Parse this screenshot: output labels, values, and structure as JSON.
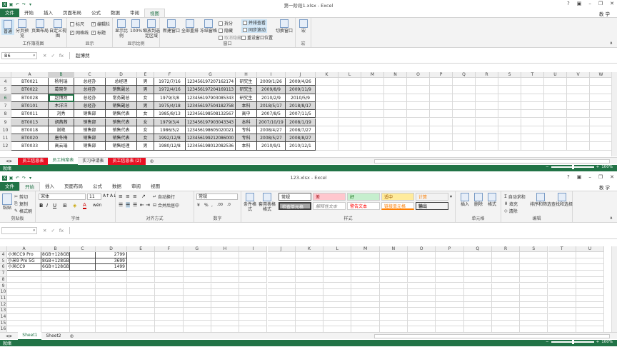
{
  "w1": {
    "title": "第一阶段1.xlsx - Excel",
    "user": "教 学",
    "tabs": [
      "文件",
      "开始",
      "插入",
      "页面布局",
      "公式",
      "数据",
      "审阅",
      "视图"
    ],
    "ribbon": {
      "workbook_views": {
        "label": "工作簿视图",
        "normal": "普通",
        "page_break": "分页预览",
        "page_layout": "页面布局",
        "custom": "自定义视图"
      },
      "show": {
        "label": "显示",
        "ruler": "标尺",
        "gridlines": "网格线",
        "formula_bar": "编辑栏",
        "headings": "标题"
      },
      "zoom": {
        "label": "显示比例",
        "zoom": "显示比例",
        "hundred": "100%",
        "to_selection": "缩放到选定区域"
      },
      "window": {
        "label": "窗口",
        "new_window": "新建窗口",
        "arrange_all": "全部重排",
        "freeze": "冻结窗格",
        "split": "拆分",
        "hide": "隐藏",
        "unhide": "取消隐藏",
        "side_by_side": "并排查看",
        "sync_scroll": "同步滚动",
        "reset_pos": "重设窗口位置",
        "switch": "切换窗口"
      },
      "macros": {
        "label": "宏",
        "macro": "宏"
      }
    },
    "namebox": "B6",
    "formula": "赵博然",
    "columns": [
      "A",
      "B",
      "C",
      "D",
      "E",
      "F",
      "G",
      "H",
      "I",
      "J",
      "K",
      "L",
      "M",
      "N",
      "O",
      "P",
      "Q",
      "R",
      "S",
      "T",
      "U",
      "V",
      "W"
    ],
    "rows": [
      {
        "n": "4",
        "cells": [
          "BT0021",
          "杨利瑞",
          "总经办",
          "总经理",
          "男",
          "1972/7/16",
          "123456197207162174",
          "研究生",
          "2009/1/26",
          "2009/4/26"
        ]
      },
      {
        "n": "5",
        "cells": [
          "BT0022",
          "葛晓冬",
          "总经办",
          "销售副总",
          "男",
          "1972/4/16",
          "123456197204169113",
          "研究生",
          "2009/8/9",
          "2009/11/9"
        ]
      },
      {
        "n": "6",
        "cells": [
          "BT0028",
          "赵博然",
          "总经办",
          "常务副总",
          "女",
          "1979/3/8",
          "123456197903085343",
          "研究生",
          "2010/2/9",
          "2010/5/9"
        ]
      },
      {
        "n": "7",
        "cells": [
          "BT0101",
          "木洋洋",
          "总经办",
          "销售副总",
          "男",
          "1975/4/18",
          "123456197504182758",
          "本科",
          "2018/5/17",
          "2018/8/17"
        ]
      },
      {
        "n": "8",
        "cells": [
          "BT0011",
          "刘秀",
          "销售部",
          "销售代表",
          "女",
          "1985/8/13",
          "123456198508132567",
          "高中",
          "2007/8/5",
          "2007/11/5"
        ]
      },
      {
        "n": "9",
        "cells": [
          "BT0013",
          "胡茜茜",
          "销售部",
          "销售代表",
          "女",
          "1979/3/4",
          "123456197903043343",
          "本科",
          "2007/10/19",
          "2008/1/19"
        ]
      },
      {
        "n": "10",
        "cells": [
          "BT0018",
          "谢艳",
          "销售部",
          "销售代表",
          "女",
          "1986/5/2",
          "123456198605020021",
          "专科",
          "2008/4/27",
          "2008/7/27"
        ]
      },
      {
        "n": "11",
        "cells": [
          "BT0020",
          "唐冬梅",
          "销售部",
          "销售代表",
          "女",
          "1992/12/8",
          "123456199212086000",
          "专科",
          "2008/5/27",
          "2008/8/27"
        ]
      },
      {
        "n": "12",
        "cells": [
          "BT0033",
          "高云端",
          "销售部",
          "销售经理",
          "男",
          "1980/12/8",
          "123456198012082536",
          "本科",
          "2010/9/1",
          "2010/12/1"
        ]
      }
    ],
    "sheets": [
      "员工信息表",
      "员工档案表",
      "实习申请表",
      "员工信息表 (2)"
    ],
    "status": "就绪",
    "zoom": "100%"
  },
  "w2": {
    "title": "123.xlsx - Excel",
    "user": "教 学",
    "tabs": [
      "文件",
      "开始",
      "插入",
      "页面布局",
      "公式",
      "数据",
      "审阅",
      "视图"
    ],
    "ribbon": {
      "clipboard": {
        "label": "剪贴板",
        "paste": "粘贴",
        "cut": "剪切",
        "copy": "复制",
        "format_painter": "格式刷"
      },
      "font": {
        "label": "字体",
        "family": "宋体",
        "size": "11"
      },
      "alignment": {
        "label": "对齐方式",
        "wrap": "自动换行",
        "merge": "合并后居中"
      },
      "number": {
        "label": "数字",
        "format": "常规"
      },
      "styles": {
        "label": "样式",
        "cond": "条件格式",
        "table": "套用表格格式",
        "normal": "常规",
        "bad": "差",
        "good": "好",
        "neutral": "适中",
        "calc": "计算",
        "check": "检查单元格",
        "explain": "解释性文本",
        "warn": "警告文本",
        "link": "链接单元格",
        "output": "输出"
      },
      "cells": {
        "label": "单元格",
        "insert": "插入",
        "delete": "删除",
        "format": "格式"
      },
      "editing": {
        "label": "编辑",
        "autosum": "自动求和",
        "fill": "填充",
        "clear": "清除",
        "sort": "排序和筛选",
        "find": "查找和选择"
      }
    },
    "namebox": "",
    "formula": "",
    "columns": [
      "A",
      "B",
      "C",
      "D",
      "E",
      "F",
      "G",
      "H",
      "I",
      "J",
      "K",
      "L",
      "M",
      "N",
      "O",
      "P",
      "Q",
      "R",
      "S",
      "T",
      "U"
    ],
    "rows": [
      {
        "n": "4",
        "cells": [
          "小米CC9 Pro",
          "8GB+128GB",
          "",
          "2799"
        ]
      },
      {
        "n": "5",
        "cells": [
          "小米9 Pro 5G",
          "8GB+128GB",
          "",
          "3699"
        ]
      },
      {
        "n": "6",
        "cells": [
          "小米CC9",
          "6GB+128GB",
          "",
          "1499"
        ]
      },
      {
        "n": "7",
        "cells": [
          "",
          "",
          "",
          ""
        ]
      },
      {
        "n": "8",
        "cells": [
          "",
          "",
          "",
          ""
        ]
      },
      {
        "n": "9",
        "cells": [
          "",
          "",
          "",
          ""
        ]
      },
      {
        "n": "10",
        "cells": [
          "",
          "",
          "",
          ""
        ]
      },
      {
        "n": "11",
        "cells": [
          "",
          "",
          "",
          ""
        ]
      },
      {
        "n": "12",
        "cells": [
          "",
          "",
          "",
          ""
        ]
      },
      {
        "n": "13",
        "cells": [
          "",
          "",
          "",
          ""
        ]
      },
      {
        "n": "14",
        "cells": [
          "",
          "",
          "",
          ""
        ]
      },
      {
        "n": "15",
        "cells": [
          "",
          "",
          "",
          ""
        ]
      },
      {
        "n": "16",
        "cells": [
          "",
          "",
          "",
          ""
        ]
      },
      {
        "n": "17",
        "cells": [
          "",
          "",
          "",
          ""
        ]
      },
      {
        "n": "18",
        "cells": [
          "",
          "",
          "",
          ""
        ]
      }
    ],
    "sheets": [
      "Sheet1",
      "Sheet2"
    ],
    "status": "就绪",
    "zoom": "100%"
  }
}
